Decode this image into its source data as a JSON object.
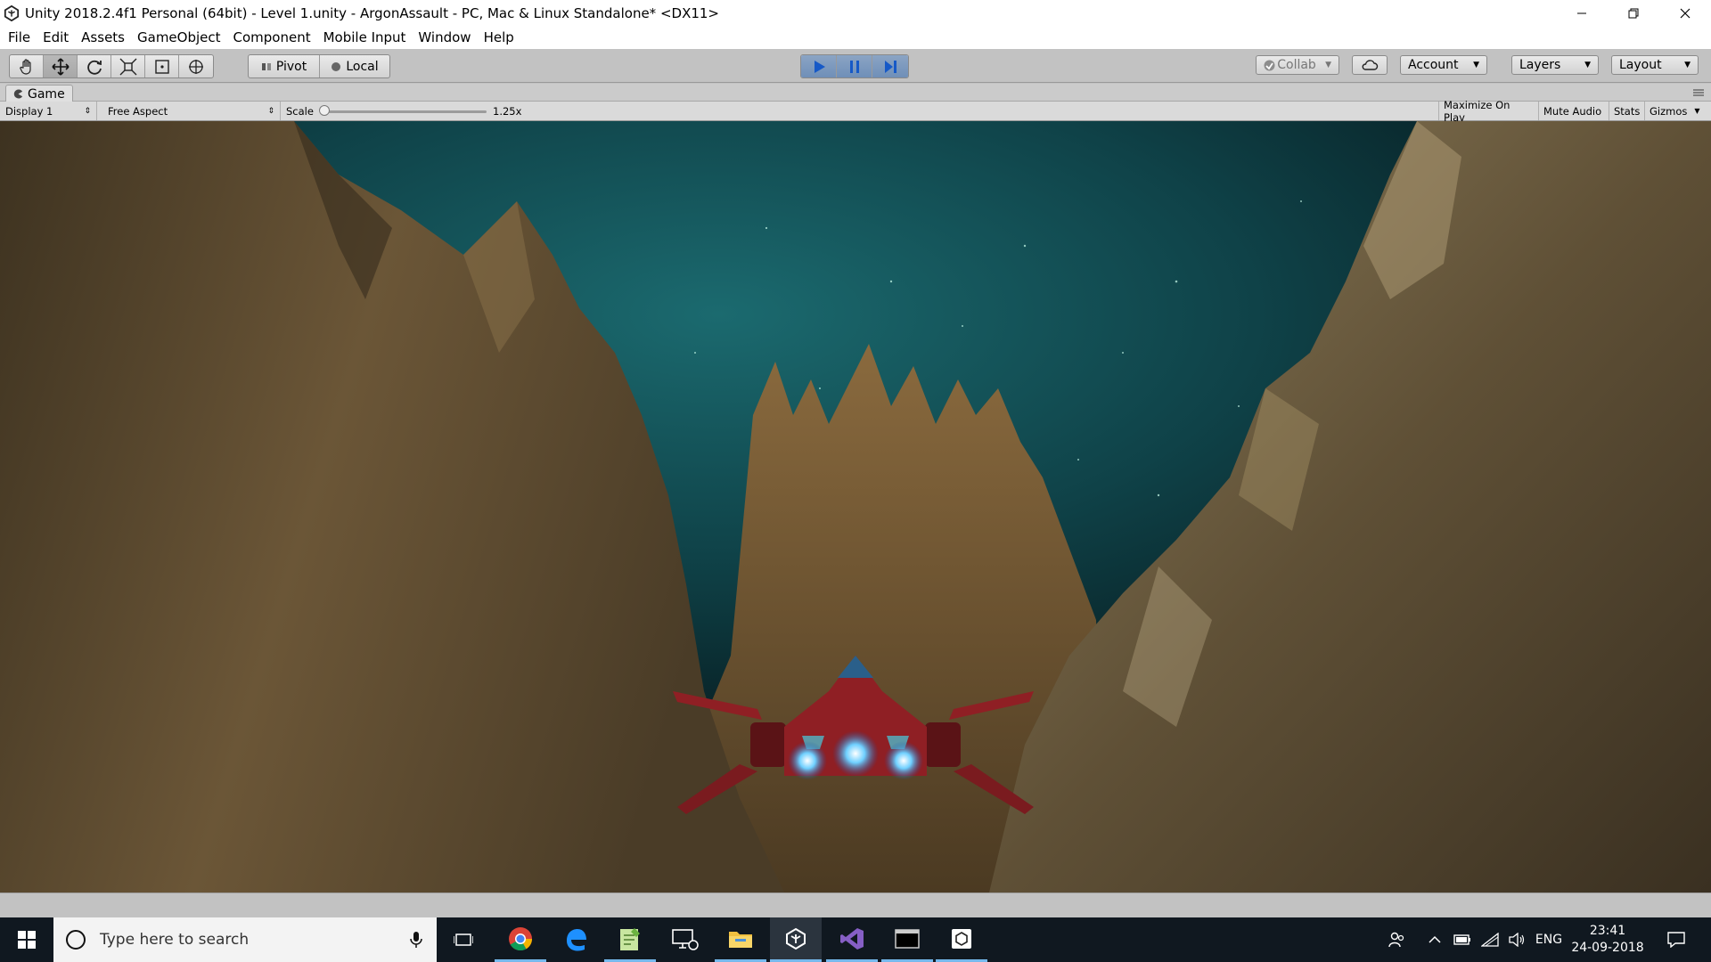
{
  "window": {
    "title": "Unity 2018.2.4f1 Personal (64bit) - Level 1.unity - ArgonAssault - PC, Mac & Linux Standalone* <DX11>"
  },
  "menu": [
    "File",
    "Edit",
    "Assets",
    "GameObject",
    "Component",
    "Mobile Input",
    "Window",
    "Help"
  ],
  "toolbar": {
    "tools": [
      "hand-tool",
      "move-tool",
      "rotate-tool",
      "scale-tool",
      "rect-tool",
      "transform-tool"
    ],
    "active_tool": "move-tool",
    "pivot_label": "Pivot",
    "local_label": "Local",
    "collab_label": "Collab",
    "account_label": "Account",
    "layers_label": "Layers",
    "layout_label": "Layout",
    "play_state": "playing"
  },
  "game_panel": {
    "tab_label": "Game",
    "display_label": "Display 1",
    "aspect_label": "Free Aspect",
    "scale_label": "Scale",
    "scale_value": "1.25x",
    "scale_level": 0.0,
    "maximize_label": "Maximize On Play",
    "mute_label": "Mute Audio",
    "stats_label": "Stats",
    "gizmos_label": "Gizmos"
  },
  "taskbar": {
    "search_placeholder": "Type here to search",
    "apps": [
      "task-view",
      "chrome",
      "edge",
      "notepad-plus",
      "remote-desktop",
      "file-explorer",
      "unity",
      "visual-studio",
      "terminal",
      "unity-hub"
    ],
    "language": "ENG",
    "time": "23:41",
    "date": "24-09-2018"
  },
  "colors": {
    "accent_play": "#3f7ad6",
    "taskbar_bg": "#101820",
    "sky": "#0f4a50",
    "rock": "#6b5233",
    "ship_red": "#8f1f24",
    "thruster": "#6fd0ff"
  }
}
